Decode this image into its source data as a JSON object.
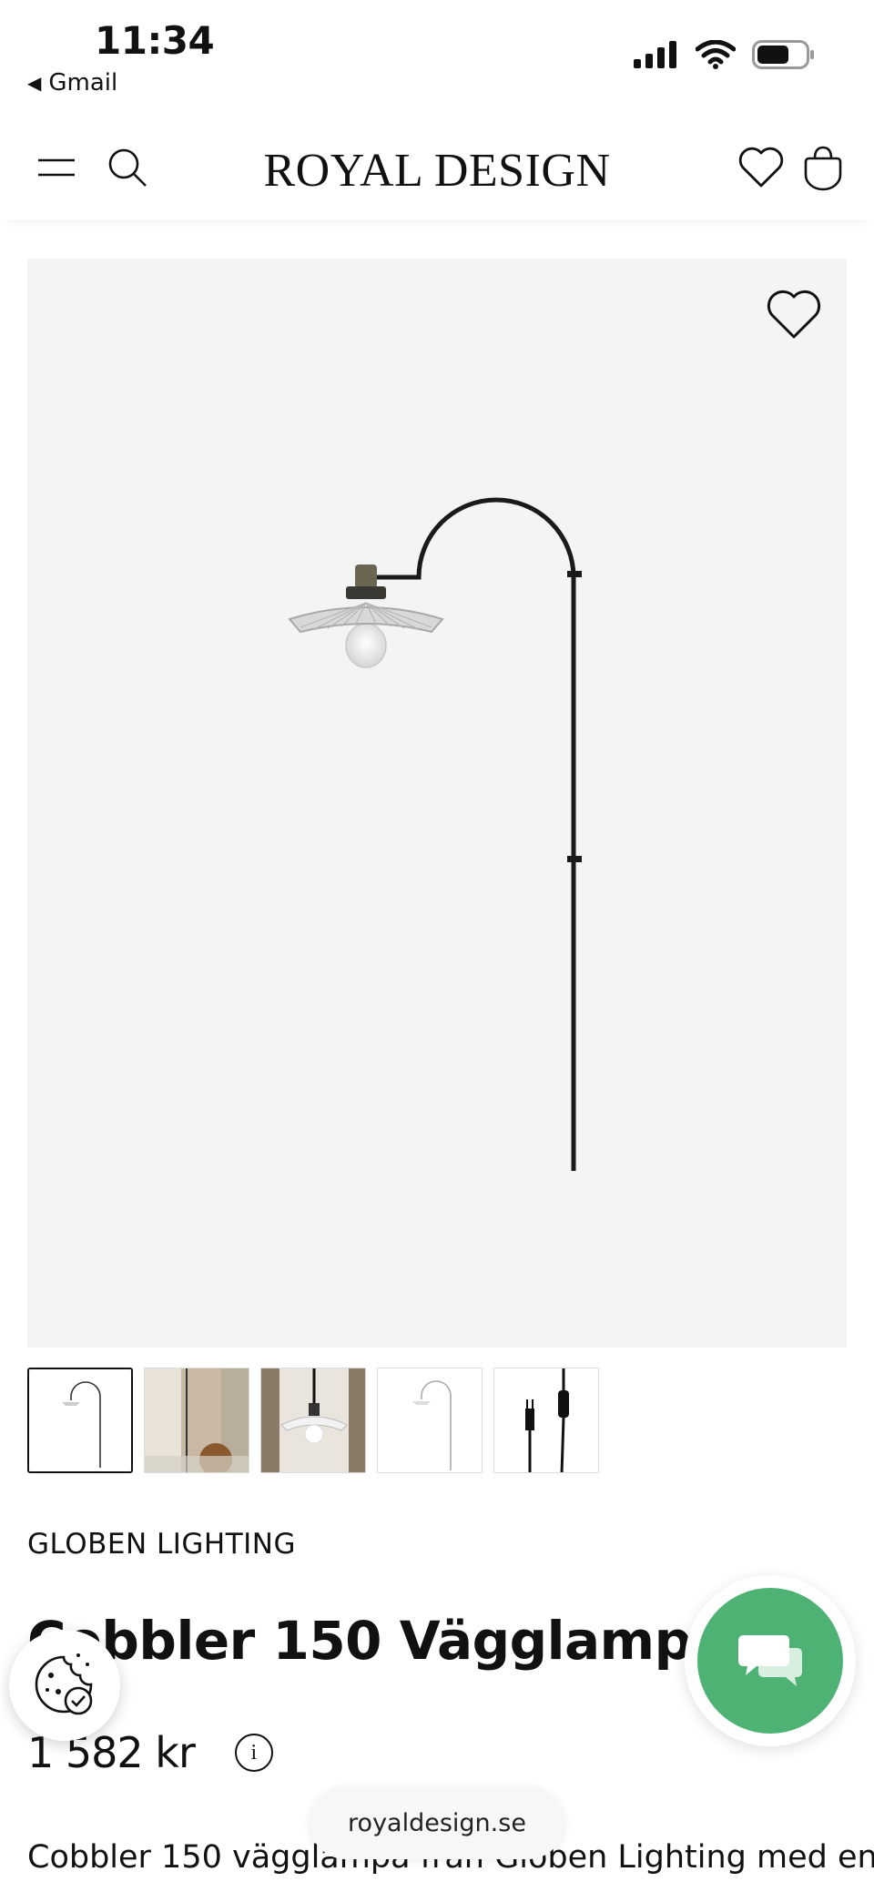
{
  "status_bar": {
    "time": "11:34",
    "back_app": "Gmail",
    "icons": [
      "signal-icon",
      "wifi-icon",
      "battery-icon"
    ]
  },
  "header": {
    "brand": "ROYAL DESIGN",
    "icons": [
      "menu-icon",
      "search-icon",
      "wishlist-icon",
      "cart-icon"
    ]
  },
  "gallery": {
    "thumbnail_count": 5,
    "active_index": 0
  },
  "product": {
    "brand": "GLOBEN LIGHTING",
    "title": "Cobbler 150 Vägglampa, ",
    "price": "1 582 kr",
    "description": "Cobbler 150 vägglampa från Globen Lighting med en"
  },
  "browser": {
    "url": "royaldesign.se"
  },
  "colors": {
    "image_bg": "#f4f4f4",
    "chat_green": "#4db273",
    "text": "#111111"
  }
}
